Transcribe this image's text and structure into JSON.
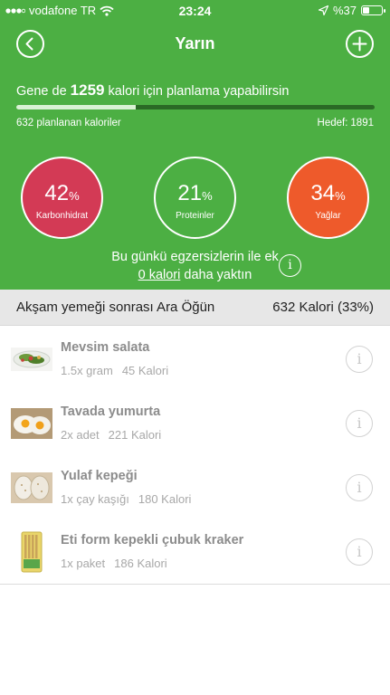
{
  "status_bar": {
    "carrier": "vodafone TR",
    "time": "23:24",
    "battery": "%37",
    "battery_level": 0.37
  },
  "nav": {
    "title": "Yarın",
    "back_icon": "back-arrow-icon",
    "add_icon": "plus-icon"
  },
  "summary": {
    "remaining_prefix": "Gene de",
    "remaining_value": "1259",
    "remaining_suffix": "kalori için planlama yapabilirsin",
    "progress_fraction": 0.334,
    "planned_label": "632 planlanan kaloriler",
    "target_label": "Hedef:",
    "target_value": "1891"
  },
  "macros": [
    {
      "percent": "42",
      "unit": "%",
      "label": "Karbonhidrat",
      "color": "#d33a55"
    },
    {
      "percent": "21",
      "unit": "%",
      "label": "Proteinler",
      "color": "#4caf43"
    },
    {
      "percent": "34",
      "unit": "%",
      "label": "Yağlar",
      "color": "#ee5a2b"
    }
  ],
  "exercise": {
    "line1": "Bu günkü egzersizlerin ile ek",
    "link": "0 kalori",
    "line2_suffix": "daha yaktın",
    "info_icon": "info-icon"
  },
  "meal": {
    "name": "Akşam yemeği sonrası Ara Öğün",
    "calories": "632 Kalori (33%)",
    "items": [
      {
        "name": "Mevsim salata",
        "amount": "1.5x gram",
        "calories": "45 Kalori",
        "icon": "salad-thumbnail"
      },
      {
        "name": "Tavada yumurta",
        "amount": "2x adet",
        "calories": "221 Kalori",
        "icon": "fried-egg-thumbnail"
      },
      {
        "name": "Yulaf kepeği",
        "amount": "1x çay kaşığı",
        "calories": "180 Kalori",
        "icon": "oat-bran-thumbnail"
      },
      {
        "name": "Eti form kepekli çubuk kraker",
        "amount": "1x paket",
        "calories": "186 Kalori",
        "icon": "cracker-package-thumbnail"
      }
    ]
  }
}
